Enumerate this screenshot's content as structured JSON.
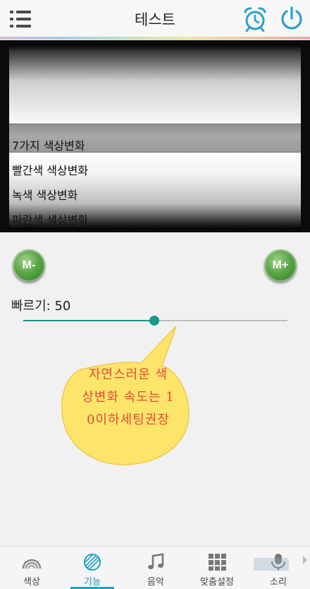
{
  "header": {
    "title": "테스트",
    "menu_icon": "menu-icon",
    "alarm_icon": "alarm-clock-icon",
    "power_icon": "power-icon"
  },
  "picker": {
    "options": [
      "7가지 색상변화",
      "빨간색 색상변화",
      "녹색 색상변화",
      "파란색 색상변화"
    ],
    "selected": "7가지 색상변화"
  },
  "controls": {
    "m_minus": "M-",
    "m_plus": "M+",
    "speed_label": "빠르기: 50",
    "speed_value": 50,
    "speed_max": 100
  },
  "bubble": {
    "lines": [
      "자연스러운 색",
      "상변화 속도는 1",
      "0이하세팅권장"
    ]
  },
  "bottom_nav": {
    "items": [
      {
        "label": "색상",
        "icon": "rainbow-icon"
      },
      {
        "label": "기능",
        "icon": "striped-circle-icon"
      },
      {
        "label": "음악",
        "icon": "music-note-icon"
      },
      {
        "label": "맞춤설정",
        "icon": "grid-icon"
      },
      {
        "label": "소리",
        "icon": "microphone-icon"
      }
    ],
    "active": "기능"
  },
  "colors": {
    "accent": "#13988a",
    "tab_active": "#1aa1c9",
    "header_icons": "#2a9fd1",
    "bubble_fill": "#fde56a",
    "bubble_text": "#e04a3c",
    "m_button": "#4f9b3e"
  }
}
